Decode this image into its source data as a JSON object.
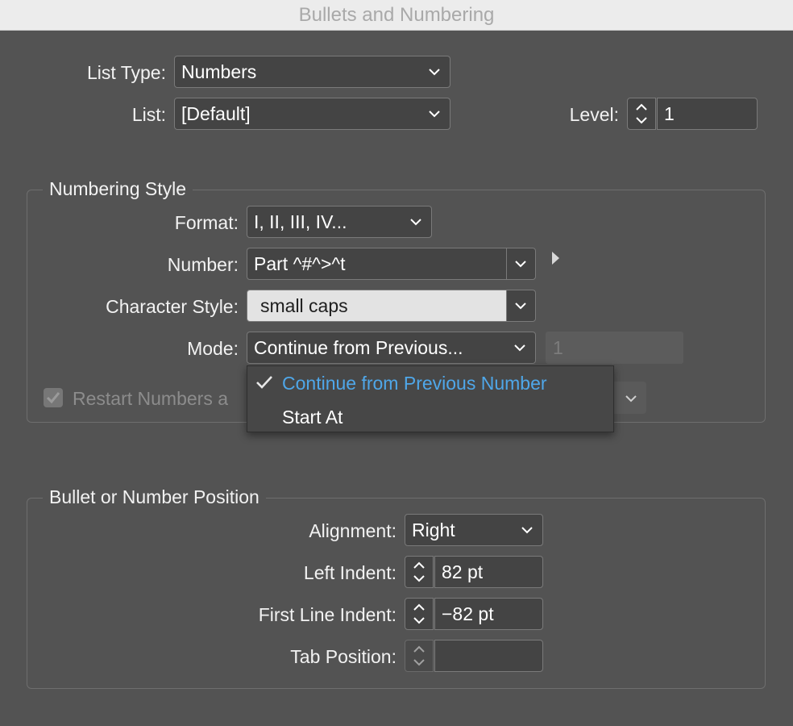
{
  "window": {
    "title": "Bullets and Numbering"
  },
  "list_type": {
    "label": "List Type:",
    "value": "Numbers"
  },
  "list": {
    "label": "List:",
    "value": "[Default]"
  },
  "level": {
    "label": "Level:",
    "value": "1"
  },
  "numbering_style": {
    "title": "Numbering Style",
    "format": {
      "label": "Format:",
      "value": "I, II, III, IV..."
    },
    "number": {
      "label": "Number:",
      "value": "Part ^#^>^t"
    },
    "character_style": {
      "label": "Character Style:",
      "value": "small caps"
    },
    "mode": {
      "label": "Mode:",
      "value": "Continue from Previous...",
      "start_at_value": "1"
    },
    "restart": {
      "label": "Restart Numbers a",
      "checked": true
    }
  },
  "mode_menu": {
    "items": [
      {
        "label": "Continue from Previous Number",
        "checked": true
      },
      {
        "label": "Start At",
        "checked": false
      }
    ]
  },
  "position": {
    "title": "Bullet or Number Position",
    "alignment": {
      "label": "Alignment:",
      "value": "Right"
    },
    "left_indent": {
      "label": "Left Indent:",
      "value": "82 pt"
    },
    "first_line_indent": {
      "label": "First Line Indent:",
      "value": "−82 pt"
    },
    "tab_position": {
      "label": "Tab Position:",
      "value": ""
    }
  },
  "colors": {
    "background": "#535353",
    "field": "#444444",
    "accent_checked": "#4fa7e9",
    "character_style_field": "#e3e3e3"
  },
  "icons": {
    "chevron": "chevron-down-icon",
    "stepper": "stepper-arrows-icon",
    "check": "checkmark-icon",
    "triangle": "triangle-right-icon"
  }
}
